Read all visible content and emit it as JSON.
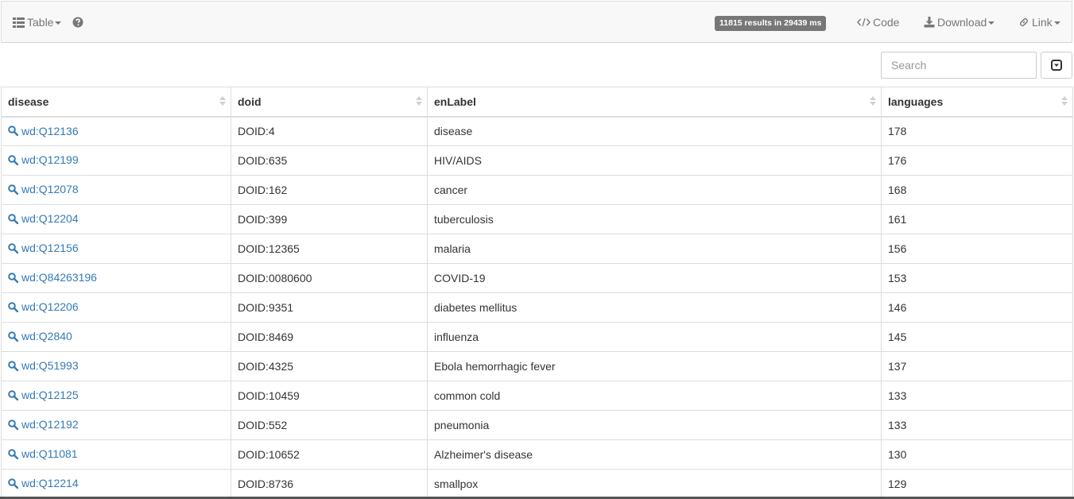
{
  "toolbar": {
    "view_label": "Table",
    "results_badge": "11815 results in 29439 ms",
    "code_label": "Code",
    "download_label": "Download",
    "link_label": "Link"
  },
  "search": {
    "placeholder": "Search"
  },
  "table": {
    "columns": [
      "disease",
      "doid",
      "enLabel",
      "languages"
    ],
    "rows": [
      {
        "disease": "wd:Q12136",
        "doid": "DOID:4",
        "enLabel": "disease",
        "languages": "178"
      },
      {
        "disease": "wd:Q12199",
        "doid": "DOID:635",
        "enLabel": "HIV/AIDS",
        "languages": "176"
      },
      {
        "disease": "wd:Q12078",
        "doid": "DOID:162",
        "enLabel": "cancer",
        "languages": "168"
      },
      {
        "disease": "wd:Q12204",
        "doid": "DOID:399",
        "enLabel": "tuberculosis",
        "languages": "161"
      },
      {
        "disease": "wd:Q12156",
        "doid": "DOID:12365",
        "enLabel": "malaria",
        "languages": "156"
      },
      {
        "disease": "wd:Q84263196",
        "doid": "DOID:0080600",
        "enLabel": "COVID-19",
        "languages": "153"
      },
      {
        "disease": "wd:Q12206",
        "doid": "DOID:9351",
        "enLabel": "diabetes mellitus",
        "languages": "146"
      },
      {
        "disease": "wd:Q2840",
        "doid": "DOID:8469",
        "enLabel": "influenza",
        "languages": "145"
      },
      {
        "disease": "wd:Q51993",
        "doid": "DOID:4325",
        "enLabel": "Ebola hemorrhagic fever",
        "languages": "137"
      },
      {
        "disease": "wd:Q12125",
        "doid": "DOID:10459",
        "enLabel": "common cold",
        "languages": "133"
      },
      {
        "disease": "wd:Q12192",
        "doid": "DOID:552",
        "enLabel": "pneumonia",
        "languages": "133"
      },
      {
        "disease": "wd:Q11081",
        "doid": "DOID:10652",
        "enLabel": "Alzheimer's disease",
        "languages": "130"
      },
      {
        "disease": "wd:Q12214",
        "doid": "DOID:8736",
        "enLabel": "smallpox",
        "languages": "129"
      }
    ]
  },
  "colors": {
    "link": "#337ab7",
    "toolbar_bg": "#f8f8f8",
    "badge_bg": "#777777",
    "border": "#dddddd"
  },
  "icons": {
    "view": "table-list-icon",
    "help": "question-circle-icon",
    "code": "code-icon",
    "download": "download-icon",
    "link": "link-icon",
    "row_link": "search-icon",
    "column_toggle": "caret-square-down-icon"
  }
}
